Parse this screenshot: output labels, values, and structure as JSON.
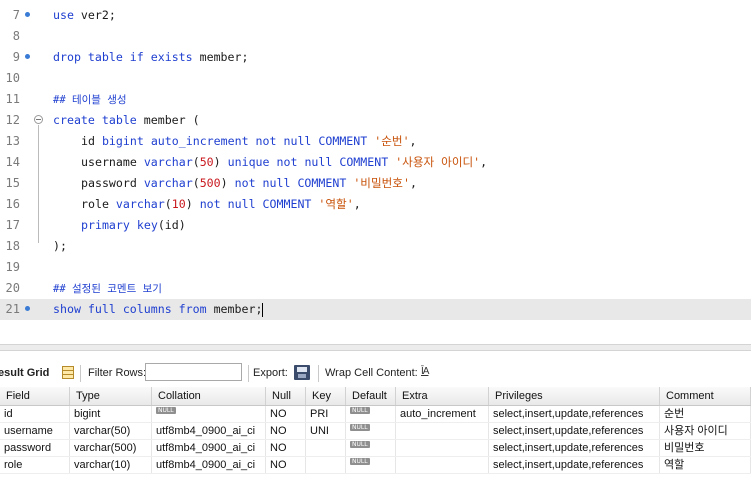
{
  "editor": {
    "lines": [
      {
        "num": "7",
        "marker": true,
        "text": "use ver2;"
      },
      {
        "num": "8",
        "text": ""
      },
      {
        "num": "9",
        "marker": true,
        "text": "drop table if exists member;"
      },
      {
        "num": "10",
        "text": ""
      },
      {
        "num": "11",
        "text": "## 테이블 생성"
      },
      {
        "num": "12",
        "fold": true,
        "text": "create table member ("
      },
      {
        "num": "13",
        "text": "id bigint auto_increment not null COMMENT '순번',"
      },
      {
        "num": "14",
        "text": "username varchar(50) unique not null COMMENT '사용자 아이디',"
      },
      {
        "num": "15",
        "text": "password varchar(500) not null COMMENT '비밀번호',"
      },
      {
        "num": "16",
        "text": "role varchar(10) not null COMMENT '역할',"
      },
      {
        "num": "17",
        "text": "primary key(id)"
      },
      {
        "num": "18",
        "text": ");"
      },
      {
        "num": "19",
        "text": ""
      },
      {
        "num": "20",
        "text": "## 설정된 코멘트 보기"
      },
      {
        "num": "21",
        "marker": true,
        "current": true,
        "text": "show full columns from member;"
      }
    ]
  },
  "toolbar": {
    "result_grid_label": "esult Grid",
    "filter_rows_label": "Filter Rows:",
    "filter_value": "",
    "export_label": "Export:",
    "wrap_label": "Wrap Cell Content:",
    "wrap_icon": "ĪA"
  },
  "grid": {
    "columns": [
      "Field",
      "Type",
      "Collation",
      "Null",
      "Key",
      "Default",
      "Extra",
      "Privileges",
      "Comment"
    ],
    "rows": [
      {
        "Field": "id",
        "Type": "bigint",
        "Collation": "NULL",
        "Null": "NO",
        "Key": "PRI",
        "Default": "NULL",
        "Extra": "auto_increment",
        "Privileges": "select,insert,update,references",
        "Comment": "순번"
      },
      {
        "Field": "username",
        "Type": "varchar(50)",
        "Collation": "utf8mb4_0900_ai_ci",
        "Null": "NO",
        "Key": "UNI",
        "Default": "NULL",
        "Extra": "",
        "Privileges": "select,insert,update,references",
        "Comment": "사용자 아이디"
      },
      {
        "Field": "password",
        "Type": "varchar(500)",
        "Collation": "utf8mb4_0900_ai_ci",
        "Null": "NO",
        "Key": "",
        "Default": "NULL",
        "Extra": "",
        "Privileges": "select,insert,update,references",
        "Comment": "비밀번호"
      },
      {
        "Field": "role",
        "Type": "varchar(10)",
        "Collation": "utf8mb4_0900_ai_ci",
        "Null": "NO",
        "Key": "",
        "Default": "NULL",
        "Extra": "",
        "Privileges": "select,insert,update,references",
        "Comment": "역할"
      }
    ]
  },
  "colors": {
    "keyword": "#1f3fd0",
    "number": "#c8181e",
    "string": "#c8520a",
    "current_line": "#e8e8e8"
  }
}
